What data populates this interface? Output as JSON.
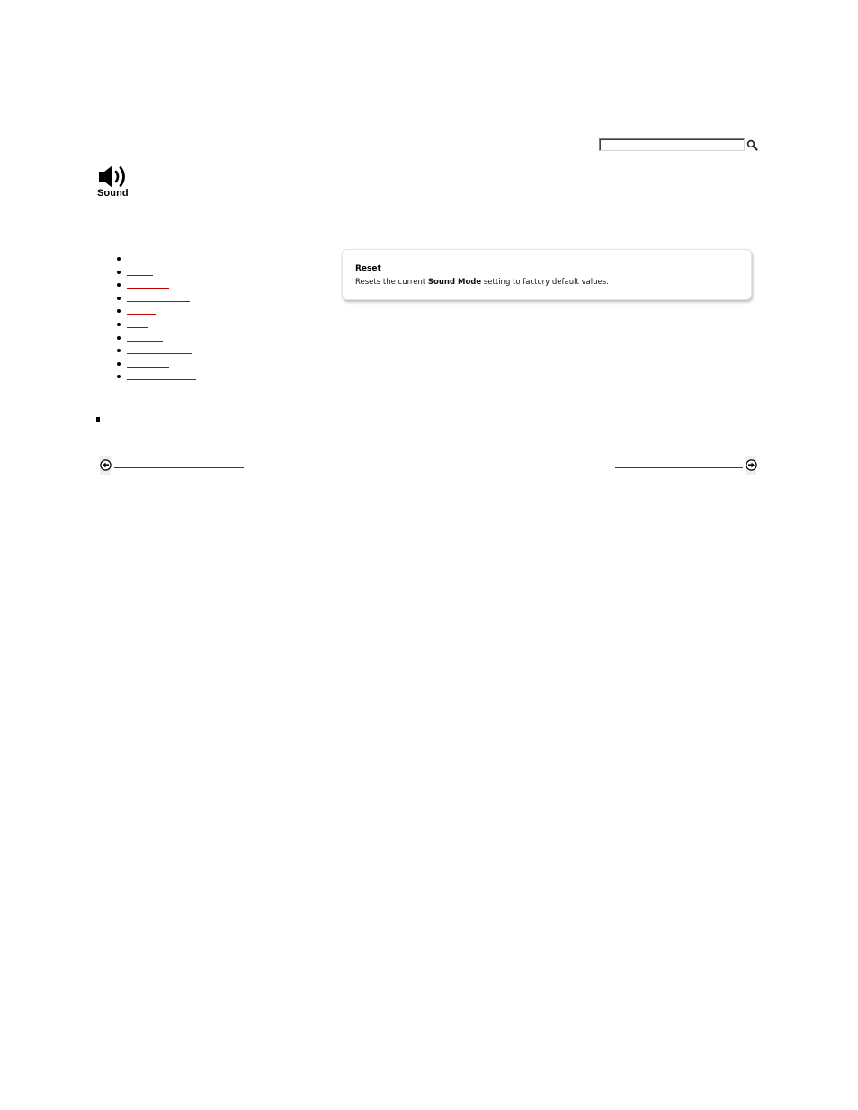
{
  "header": {
    "breadcrumb_links": [
      "",
      ""
    ],
    "search": {
      "placeholder": "",
      "value": "",
      "button_icon": "search-icon"
    }
  },
  "section": {
    "icon": "speaker-icon",
    "title": "Sound"
  },
  "nav_list": {
    "items": [
      "",
      "",
      "",
      "",
      "",
      "",
      "",
      "",
      "",
      ""
    ]
  },
  "info_card": {
    "title": "Reset",
    "text_before": "Resets the current ",
    "text_bold": "Sound Mode",
    "text_after": " setting to factory default values."
  },
  "footer_nav": {
    "prev_label": "",
    "next_label": "",
    "prev_icon": "arrow-left-circle-icon",
    "next_icon": "arrow-right-circle-icon"
  },
  "colors": {
    "link": "#c00000",
    "text": "#000000",
    "card_border": "#e4e4e4"
  }
}
